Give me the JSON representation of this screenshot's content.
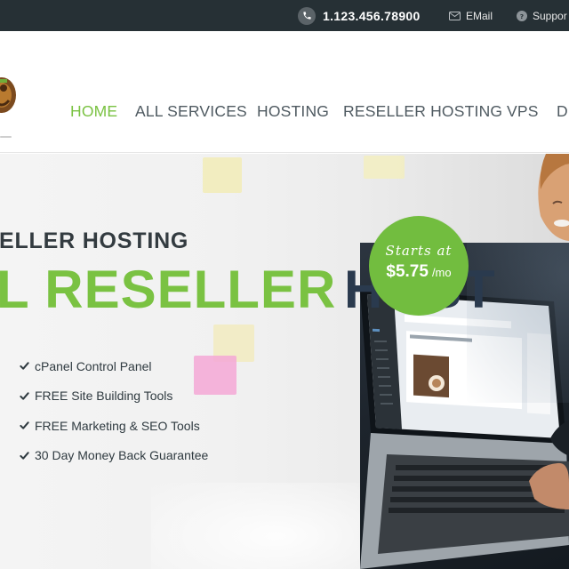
{
  "topbar": {
    "phone": "1.123.456.78900",
    "email_label": "EMail",
    "support_label": "Suppor"
  },
  "nav": {
    "items": [
      {
        "label": "HOME",
        "active": true
      },
      {
        "label": "ALL SERVICES",
        "active": false
      },
      {
        "label": "HOSTING",
        "active": false
      },
      {
        "label": "RESELLER HOSTING",
        "active": false
      },
      {
        "label": "VPS",
        "active": false
      },
      {
        "label": "DE",
        "active": false
      }
    ]
  },
  "hero": {
    "eyebrow": "ELLER HOSTING",
    "headline_green": "L RESELLER",
    "headline_dark": "HOST",
    "features": [
      "cPanel Control Panel",
      "FREE Site Building Tools",
      "FREE Marketing & SEO Tools",
      "30 Day Money Back Guarantee"
    ],
    "badge": {
      "label": "Starts at",
      "price": "$5.75",
      "unit": "/mo"
    }
  },
  "colors": {
    "topbar_bg": "#263035",
    "accent_green": "#7ac242",
    "nav_text": "#4f5a61",
    "headline_dark": "#2a3a4e"
  },
  "icons": {
    "phone": "phone-icon",
    "email": "envelope-icon",
    "support": "question-icon",
    "feature": "check-icon",
    "logo": "logo-icon"
  }
}
